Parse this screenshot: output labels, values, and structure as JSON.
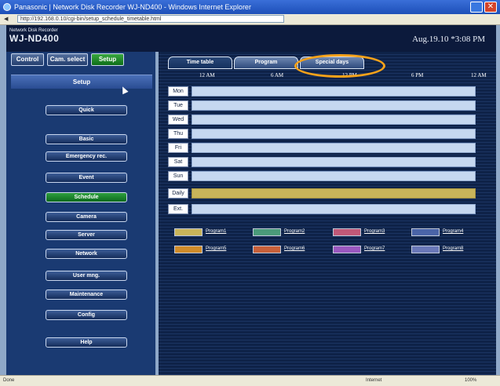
{
  "window": {
    "title": "Panasonic | Network Disk Recorder WJ-ND400 - Windows Internet Explorer",
    "address": "http://192.168.0.10/cgi-bin/setup_schedule_timetable.html"
  },
  "header": {
    "brand_small": "Network Disk Recorder",
    "brand": "WJ-ND400",
    "datetime": "Aug.19.10 *3:08 PM"
  },
  "left_tabs": [
    "Control",
    "Cam. select",
    "Setup"
  ],
  "setup_title": "Setup",
  "menu": [
    "Quick",
    "Basic",
    "Emergency rec.",
    "Event",
    "Schedule",
    "Camera",
    "Server",
    "Network",
    "User mng.",
    "Maintenance",
    "Config",
    "Help"
  ],
  "right_tabs": [
    "Time table",
    "Program",
    "Special days"
  ],
  "time_axis": [
    "12 AM",
    "6 AM",
    "12 PM",
    "6 PM",
    "12 AM"
  ],
  "days": [
    "Mon",
    "Tue",
    "Wed",
    "Thu",
    "Fri",
    "Sat",
    "Sun",
    "Daily",
    "Ext."
  ],
  "programs": [
    {
      "label": "Program1",
      "color": "#c8b45a"
    },
    {
      "label": "Program2",
      "color": "#4a9a7a"
    },
    {
      "label": "Program3",
      "color": "#c05878"
    },
    {
      "label": "Program4",
      "color": "#4a64a8"
    },
    {
      "label": "Program5",
      "color": "#d08c2a"
    },
    {
      "label": "Program6",
      "color": "#c8603a"
    },
    {
      "label": "Program7",
      "color": "#9a58c0"
    },
    {
      "label": "Program8",
      "color": "#6a78b8"
    }
  ],
  "status": {
    "left": "Done",
    "zone": "Internet",
    "zoom": "100%"
  }
}
